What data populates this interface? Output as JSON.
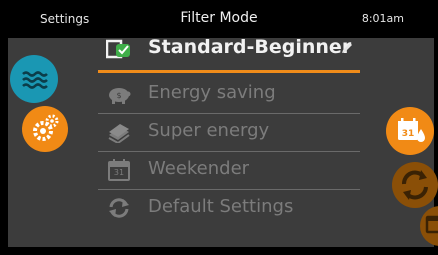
{
  "header": {
    "settings_label": "Settings",
    "title": "Filter Mode",
    "time": "8:01am"
  },
  "menu": {
    "items": [
      {
        "label": "Standard-Beginner",
        "icon": "standard-program-icon",
        "selected": true
      },
      {
        "label": "Energy saving",
        "icon": "piggy-bank-icon",
        "selected": false
      },
      {
        "label": "Super energy",
        "icon": "money-stack-icon",
        "selected": false
      },
      {
        "label": "Weekender",
        "icon": "calendar-icon",
        "selected": false
      },
      {
        "label": "Default Settings",
        "icon": "reset-arrows-icon",
        "selected": false
      }
    ],
    "calendar_icon_day": "31"
  },
  "side_buttons": {
    "left": [
      "water-waves-icon",
      "gears-icon"
    ],
    "right": [
      "calendar-drop-icon",
      "cycle-icon",
      "calendar-icon"
    ],
    "right_calendar_day": "31"
  },
  "colors": {
    "accent": "#f18a15",
    "water_blue": "#1a97b3",
    "dim_orange": "#8a4f07",
    "panel_bg": "#3c3c3c"
  }
}
